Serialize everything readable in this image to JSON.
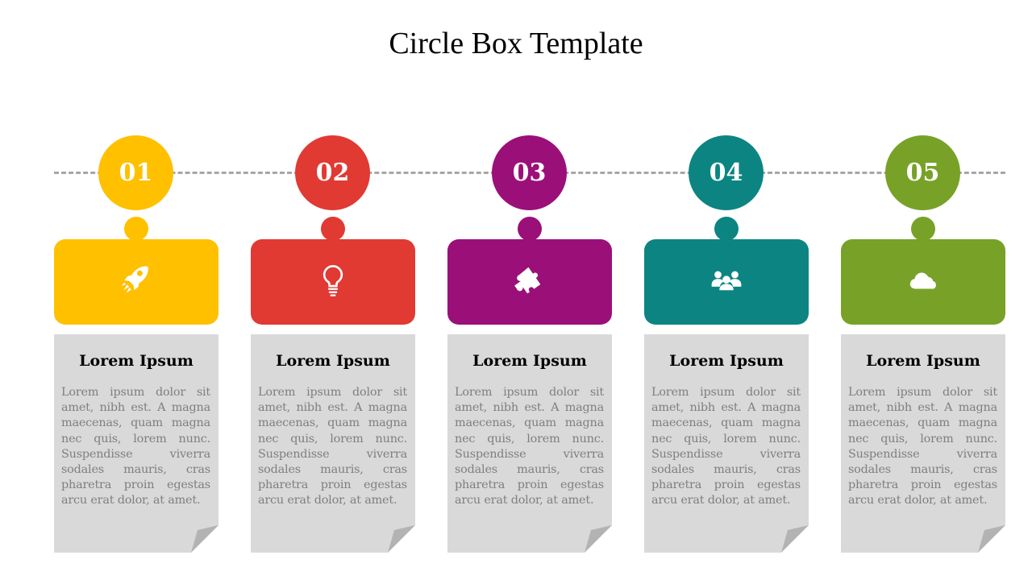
{
  "title": "Circle Box Template",
  "colors": {
    "line": "#a6a6a6",
    "note_bg": "#d9d9d9",
    "note_fold": "#b3b3b3",
    "text_body": "#7f7f7f"
  },
  "steps": [
    {
      "number": "01",
      "color": "#ffc000",
      "icon": "rocket-icon",
      "heading": "Lorem Ipsum",
      "body": "Lorem ipsum dolor sit amet, nibh est. A magna maecenas, quam magna nec quis, lorem nunc. Suspendisse viverra sodales mauris, cras pharetra proin egestas arcu erat dolor, at amet."
    },
    {
      "number": "02",
      "color": "#e03a33",
      "icon": "lightbulb-icon",
      "heading": "Lorem Ipsum",
      "body": "Lorem ipsum dolor sit amet, nibh est. A magna maecenas, quam magna nec quis, lorem nunc. Suspendisse viverra sodales mauris, cras pharetra proin egestas arcu erat dolor, at amet."
    },
    {
      "number": "03",
      "color": "#9b0f79",
      "icon": "puzzle-icon",
      "heading": "Lorem Ipsum",
      "body": "Lorem ipsum dolor sit amet, nibh est. A magna maecenas, quam magna nec quis, lorem nunc. Suspendisse viverra sodales mauris, cras pharetra proin egestas arcu erat dolor, at amet."
    },
    {
      "number": "04",
      "color": "#0c8582",
      "icon": "users-icon",
      "heading": "Lorem Ipsum",
      "body": "Lorem ipsum dolor sit amet, nibh est. A magna maecenas, quam magna nec quis, lorem nunc. Suspendisse viverra sodales mauris, cras pharetra proin egestas arcu erat dolor, at amet."
    },
    {
      "number": "05",
      "color": "#77a227",
      "icon": "cloud-icon",
      "heading": "Lorem Ipsum",
      "body": "Lorem ipsum dolor sit amet, nibh est. A magna maecenas, quam magna nec quis, lorem nunc. Suspendisse viverra sodales mauris, cras pharetra proin egestas arcu erat dolor, at amet."
    }
  ]
}
